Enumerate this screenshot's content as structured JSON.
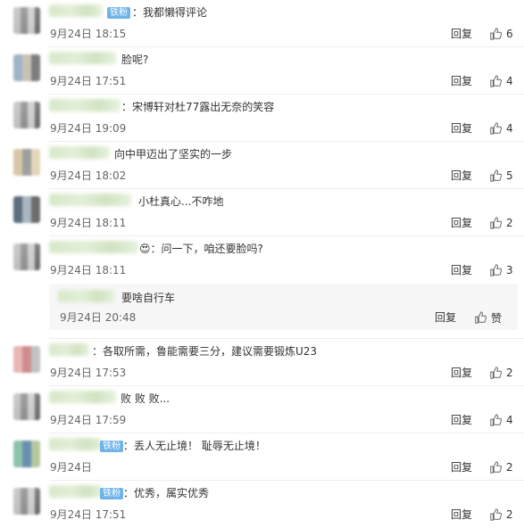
{
  "reply_label": "回复",
  "comments": [
    {
      "name_w": 60,
      "badge": "铁粉",
      "text": "：我都懒得评论",
      "time": "9月24日 18:15",
      "likes": "6",
      "avatar": "v1",
      "text_left": 148
    },
    {
      "name_w": 75,
      "badge": "",
      "text": "脸呢?",
      "time": "9月24日 17:51",
      "likes": "4",
      "avatar": "v2",
      "text_left": 136
    },
    {
      "name_w": 80,
      "badge": "",
      "text": "：宋博轩对杜77露出无奈的笑容",
      "time": "9月24日 19:09",
      "likes": "4",
      "avatar": "v1",
      "text_left": 136
    },
    {
      "name_w": 68,
      "badge": "",
      "text": "向中甲迈出了坚实的一步",
      "time": "9月24日 18:02",
      "likes": "5",
      "avatar": "v3",
      "text_left": 128
    },
    {
      "name_w": 92,
      "badge": "",
      "text": "小杜真心...不咋地",
      "time": "9月24日 18:11",
      "likes": "2",
      "avatar": "v4",
      "text_left": 155
    },
    {
      "name_w": 100,
      "badge": "",
      "text": "😍：问一下，咱还要脸吗?",
      "time": "9月24日 18:11",
      "likes": "3",
      "avatar": "v1",
      "text_left": 156
    },
    {
      "name_w": 45,
      "badge": "",
      "text": "：各取所需，鲁能需要三分，建议需要锻炼U23",
      "time": "9月24日 17:53",
      "likes": "2",
      "avatar": "v5",
      "text_left": 103
    },
    {
      "name_w": 75,
      "badge": "",
      "text": "败 败 败...",
      "time": "9月24日 17:59",
      "likes": "4",
      "avatar": "v1",
      "text_left": 135
    },
    {
      "name_w": 60,
      "badge": "铁粉",
      "text": "：丢人无止境！ 耻辱无止境！",
      "time": "9月24日",
      "likes": "2",
      "avatar": "v6",
      "text_left": 138
    },
    {
      "name_w": 60,
      "badge": "铁粉",
      "text": "：优秀，属实优秀",
      "time": "9月24日 17:51",
      "likes": "2",
      "avatar": "v1",
      "text_left": 138
    }
  ],
  "subreply": {
    "text": "要啥自行车",
    "time": "9月24日 20:48",
    "like_label": "赞"
  }
}
